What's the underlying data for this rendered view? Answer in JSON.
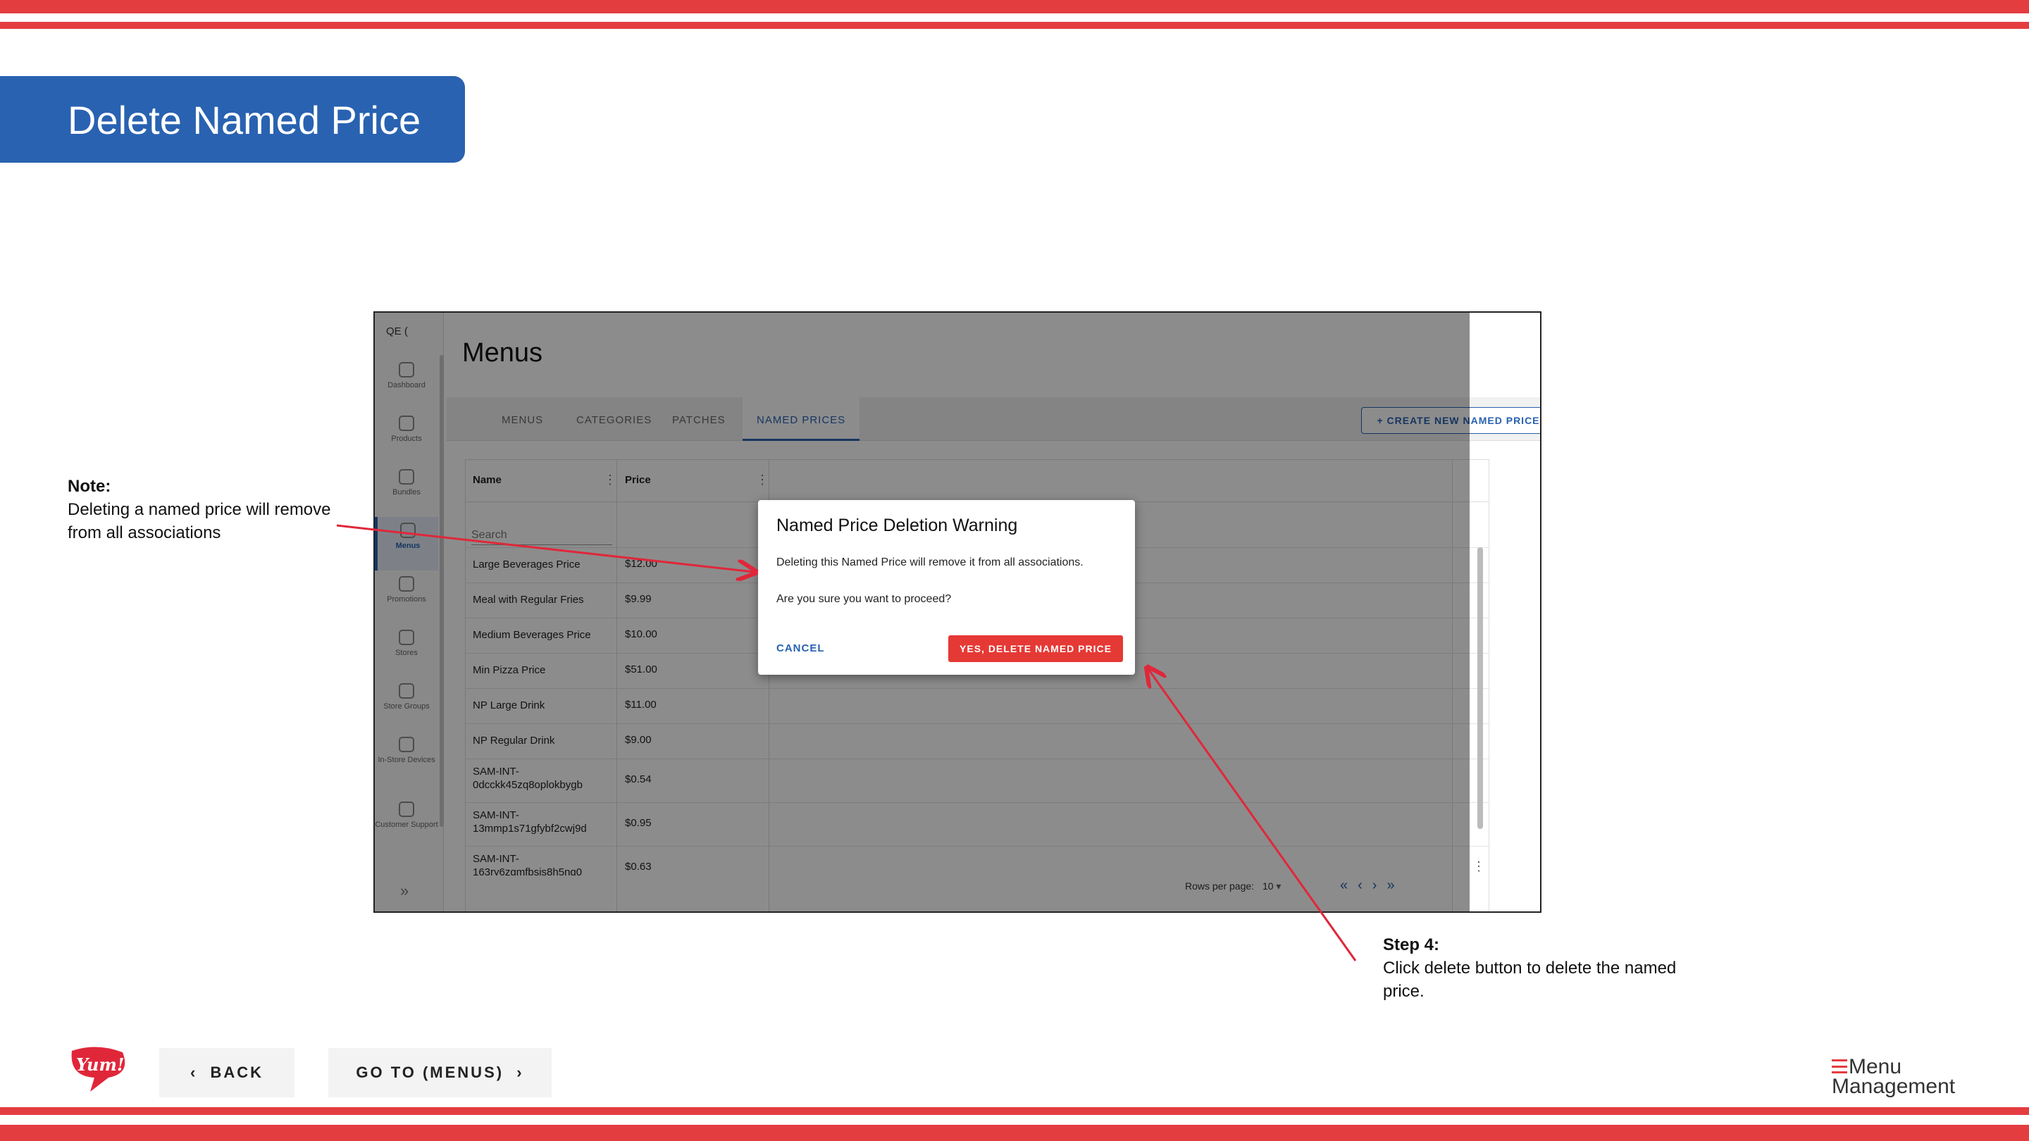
{
  "slide": {
    "title": "Delete Named Price",
    "note_heading": "Note:",
    "note_text": "Deleting a named price will remove from all associations",
    "step_heading": "Step 4:",
    "step_text": "Click delete button to delete the named price.",
    "back_label": "BACK",
    "next_label": "GO TO (MENUS)",
    "brand_logo": "Yum!",
    "product_logo_line1": "Menu",
    "product_logo_line2": "Management",
    "accent_color": "#e43d40",
    "title_bg_color": "#2962b1"
  },
  "app": {
    "org_label": "QE (",
    "page_title": "Menus",
    "nav": [
      {
        "label": "Dashboard",
        "icon": "home-icon"
      },
      {
        "label": "Products",
        "icon": "bag-icon"
      },
      {
        "label": "Bundles",
        "icon": "cube-icon"
      },
      {
        "label": "Menus",
        "icon": "document-icon",
        "active": true
      },
      {
        "label": "Promotions",
        "icon": "tag-icon"
      },
      {
        "label": "Stores",
        "icon": "store-icon"
      },
      {
        "label": "Store Groups",
        "icon": "grid-icon"
      },
      {
        "label": "In-Store Devices",
        "icon": "monitor-icon"
      },
      {
        "label": "Customer Support",
        "icon": "support-icon"
      }
    ],
    "tabs": [
      "MENUS",
      "CATEGORIES",
      "PATCHES",
      "NAMED PRICES"
    ],
    "active_tab": "NAMED PRICES",
    "create_button": "CREATE NEW NAMED PRICE",
    "table": {
      "columns": [
        "Name",
        "Price"
      ],
      "search_placeholder": "Search",
      "rows": [
        {
          "name": "Large Beverages Price",
          "price": "$12.00"
        },
        {
          "name": "Meal with Regular Fries",
          "price": "$9.99"
        },
        {
          "name": "Medium Beverages Price",
          "price": "$10.00"
        },
        {
          "name": "Min Pizza Price",
          "price": "$51.00"
        },
        {
          "name": "NP Large Drink",
          "price": "$11.00"
        },
        {
          "name": "NP Regular Drink",
          "price": "$9.00"
        },
        {
          "name": "SAM-INT-0dcckk45zq8oplokbygb",
          "price": "$0.54"
        },
        {
          "name": "SAM-INT-13mmp1s71gfybf2cwj9d",
          "price": "$0.95"
        },
        {
          "name": "SAM-INT-163ry6zgmfbsjs8h5nq0",
          "price": "$0.63"
        }
      ]
    },
    "pagination": {
      "rows_per_page_label": "Rows per page:",
      "rows_per_page": "10"
    },
    "dialog": {
      "title": "Named Price Deletion Warning",
      "body": "Deleting this Named Price will remove it from all associations.",
      "question": "Are you sure you want to proceed?",
      "cancel": "CANCEL",
      "confirm": "YES, DELETE NAMED PRICE"
    }
  }
}
